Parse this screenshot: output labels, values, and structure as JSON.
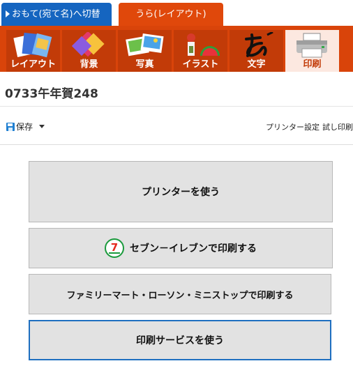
{
  "tabs": {
    "front_label": "おもて(宛て名)へ切替",
    "back_label": "うら(レイアウト)"
  },
  "tools": [
    {
      "label": "レイアウト",
      "icon": "layout-icon"
    },
    {
      "label": "背景",
      "icon": "background-icon"
    },
    {
      "label": "写真",
      "icon": "photo-icon"
    },
    {
      "label": "イラスト",
      "icon": "illustration-icon"
    },
    {
      "label": "文字",
      "icon": "text-icon"
    },
    {
      "label": "印刷",
      "icon": "printer-icon",
      "active": true
    }
  ],
  "document": {
    "title": "0733午年賀248"
  },
  "actionbar": {
    "save_label": "保存",
    "printer_settings_label": "プリンター設定",
    "test_print_label": "試し印刷"
  },
  "buttons": {
    "use_printer": "プリンターを使う",
    "seven_eleven": "セブン－イレブンで印刷する",
    "seven_logo_text": "7",
    "famima": "ファミリーマート・ローソン・ミニストップで印刷する",
    "print_service": "印刷サービスを使う"
  },
  "colors": {
    "accent_orange": "#d9440a",
    "tab_blue": "#1565c0",
    "selected_border": "#1e6fc0"
  }
}
